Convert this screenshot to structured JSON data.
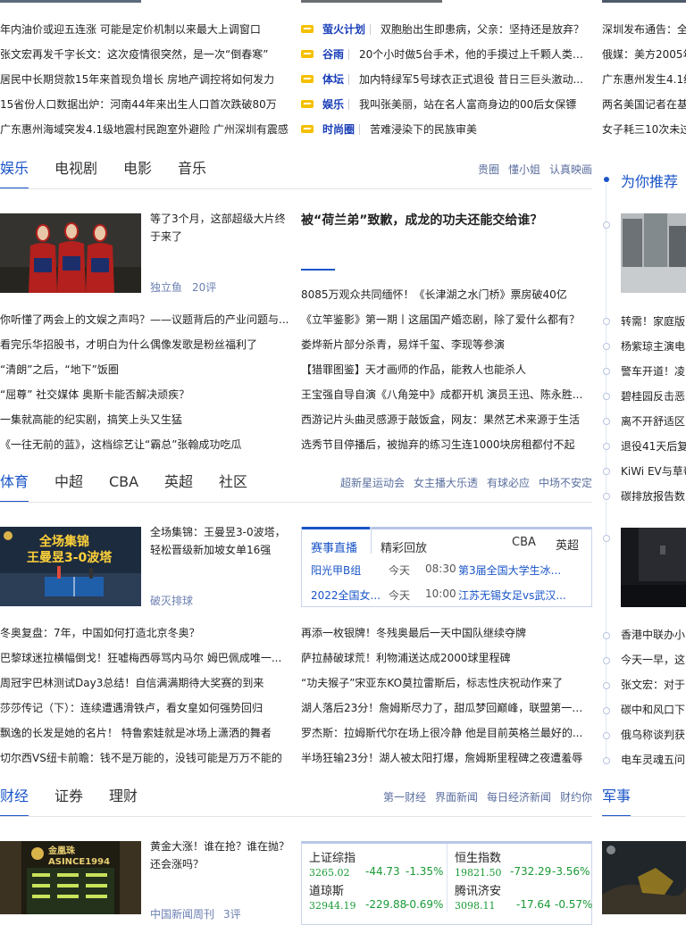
{
  "top_left_news": [
    "年内油价或迎五连涨 可能是定价机制以来最大上调窗口",
    "张文宏再发千字长文：这次疫情很突然，是一次“倒春寒”",
    "居民中长期贷款15年来首现负增长 房地产调控将如何发力",
    "15省份人口数据出炉：河南44年来出生人口首次跌破80万",
    "广东惠州海域突发4.1级地震村民跑室外避险 广州深圳有震感"
  ],
  "top_mid_news": [
    {
      "tag": "萤火计划",
      "text": "双胞胎出生即患病，父亲：坚持还是放弃？"
    },
    {
      "tag": "谷雨",
      "text": "20个小时做5台手术，他的手摸过上千颗人类的肺"
    },
    {
      "tag": "体坛",
      "text": "加内特绿军5号球衣正式退役 昔日三巨头激动..."
    },
    {
      "tag": "娱乐",
      "text": "我叫张美丽，站在名人富商身边的00后女保镖"
    },
    {
      "tag": "时尚圈",
      "text": "苦难浸染下的民族审美"
    }
  ],
  "top_right_news": [
    "深圳发布通告：全",
    "俄媒：美方2005年",
    "广东惠州发生4.1级",
    "两名美国记者在基",
    "女子耗三10次未过"
  ],
  "entertainment": {
    "tabs": [
      "娱乐",
      "电视剧",
      "电影",
      "音乐"
    ],
    "links": [
      "贵圈",
      "懂小姐",
      "认真映画"
    ],
    "featured_title": "等了3个月，这部超级大片终于来了",
    "featured_source": "独立鱼",
    "featured_comments": "20评",
    "headline": "被“荷兰弟”致歉，成龙的功夫还能交给谁？",
    "left_news": [
      "你听懂了两会上的文娱之声吗？——议题背后的产业问题与...",
      "看完乐华招股书，才明白为什么偶像发歌是粉丝福利了",
      "“清朗”之后，“地下”饭圈",
      "“屈尊” 社交媒体 奥斯卡能否解决顽疾？",
      "一集就高能的纪实剧，搞笑上头又生猛",
      "《一往无前的蓝》，这档综艺让“霸总”张翰成功吃瓜"
    ],
    "right_news": [
      "8085万观众共同缅怀！《长津湖之水门桥》票房破40亿",
      "《立竿鉴影》第一期丨这届国产婚恋剧，除了爱什么都有？",
      "娄烨新片部分杀青，易烊千玺、李现等参演",
      "【猎罪图鉴】天才画师的作品，能救人也能杀人",
      "王宝强自导自演《八角笼中》成都开机 演员王迅、陈永胜...",
      "西游记片头曲灵感源于敲饭盒，网友：果然艺术来源于生活",
      "选秀节目停播后，被抛弃的练习生连1000块房租都付不起"
    ]
  },
  "sports": {
    "tabs": [
      "体育",
      "中超",
      "CBA",
      "英超",
      "社区"
    ],
    "links": [
      "超新星运动会",
      "女主播大乐透",
      "有球必应",
      "中场不安定"
    ],
    "featured_title": "全场集锦：王曼昱3-0波塔，轻松晋级新加坡女单16强",
    "featured_source": "破灭排球",
    "image_caption_top": "全场集锦",
    "image_caption_sub": "王曼昱3-0波塔",
    "panel": {
      "tabs": [
        "赛事直播",
        "精彩回放"
      ],
      "leagues": [
        "CBA",
        "英超"
      ],
      "rows": [
        {
          "league": "阳光甲B组",
          "day": "今天",
          "time": "08:30",
          "title": "第3届全国大学生冰..."
        },
        {
          "league": "2022全国女...",
          "day": "今天",
          "time": "10:00",
          "title": "江苏无锡女足vs武汉..."
        }
      ]
    },
    "left_news": [
      "冬奥复盘：7年，中国如何打造北京冬奥？",
      "巴黎球迷拉横幅倒戈！狂嘘梅西辱骂内马尔 姆巴佩成唯一...",
      "周冠宇巴林测试Day3总结！自信满满期待大奖赛的到来",
      "莎莎传记（下）：连续遭遇滑铁卢，看女皇如何强势回归",
      "飘逸的长发是她的名片！ 特鲁索娃就是冰场上潇洒的舞者",
      "切尔西VS纽卡前瞻：钱不是万能的，没钱可能是万万不能的"
    ],
    "right_news": [
      "再添一枚银牌！冬残奥最后一天中国队继续夺牌",
      "萨拉赫破球荒！利物浦送达成2000球里程碑",
      "“功夫猴子”宋亚东KO莫拉雷斯后，标志性庆祝动作来了",
      "湖人落后23分！詹姆斯尽力了，甜瓜梦回巅峰，联盟第一太狠",
      "罗杰斯：拉姆斯代尔在场上很冷静 他是目前英格兰最好的...",
      "半场狂输23分！湖人被太阳打爆，詹姆斯里程碑之夜遭羞辱"
    ]
  },
  "finance": {
    "tabs": [
      "财经",
      "证券",
      "理财"
    ],
    "links": [
      "第一财经",
      "界面新闻",
      "每日经济新闻",
      "财约你"
    ],
    "featured_title": "黄金大涨！谁在抢？谁在抛？还会涨吗？",
    "featured_source": "中国新闻周刊",
    "featured_comments": "3评",
    "image_caption": "金凰珠 ASINCE1994",
    "stocks": [
      {
        "name": "上证综指",
        "price": "3265.02",
        "change": "-44.73",
        "pct": "-1.35%"
      },
      {
        "name": "恒生指数",
        "price": "19821.50",
        "change": "-732.29",
        "pct": "-3.56%"
      },
      {
        "name": "道琼斯",
        "price": "32944.19",
        "change": "-229.88",
        "pct": "-0.69%"
      },
      {
        "name": "腾讯济安",
        "price": "3098.11",
        "change": "-17.64",
        "pct": "-0.57%"
      }
    ]
  },
  "sidebar": {
    "recommend_title": "为你推荐",
    "news_a": [
      "转需！家庭版",
      "杨紫琼主演电",
      "警车开道！凌",
      "碧桂园反击恶",
      "离不开舒适区",
      "退役41天后复",
      "KiWi EV与草莓",
      "碳排放报告数"
    ],
    "news_b": [
      "香港中联办小",
      "今天一早，这",
      "张文宏：对于",
      "碳中和风口下",
      "俄乌称谈判获",
      "电车灵魂五问"
    ],
    "military_title": "军事"
  },
  "colors": {
    "accent": "#1a55c8",
    "tag": "#1a3fb8",
    "down": "#199a35",
    "ticker_blue": "#1a55c8"
  }
}
